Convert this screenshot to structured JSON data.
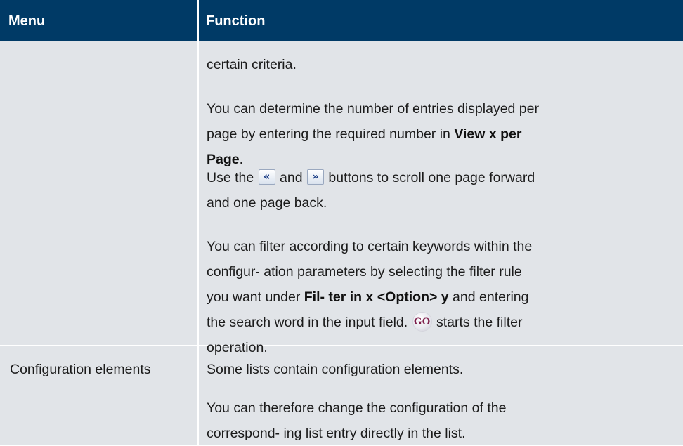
{
  "table": {
    "headers": {
      "menu": "Menu",
      "function": "Function"
    },
    "rows": [
      {
        "menu": "",
        "function": {
          "p1": "certain criteria.",
          "p2_part1": "You can determine the number of entries displayed per page by entering the required number in ",
          "p2_bold": "View x per Page",
          "p2_part2": ".",
          "p3_part1": "Use the ",
          "p3_icon_prev": "«",
          "p3_part2": " and ",
          "p3_icon_next": "»",
          "p3_part3": " buttons to scroll one page forward and one page back.",
          "p4_part1": "You can filter according to certain keywords within the configur- ation parameters by selecting the filter rule you want under ",
          "p4_bold": "Fil- ter in x <Option> y",
          "p4_part2": " and entering the search word in the input field. ",
          "p4_icon_go": "GO",
          "p4_part3": " starts the filter operation."
        }
      },
      {
        "menu": "Configuration elements",
        "function": {
          "p1": "Some lists contain configuration elements.",
          "p2": "You can therefore change the configuration of the correspond- ing list entry directly in the list."
        }
      }
    ]
  },
  "colors": {
    "header_bg": "#003a66",
    "header_text": "#ffffff",
    "cell_bg": "#e1e4e8"
  },
  "icons": [
    "scroll-back-icon",
    "scroll-forward-icon",
    "go-filter-icon"
  ]
}
